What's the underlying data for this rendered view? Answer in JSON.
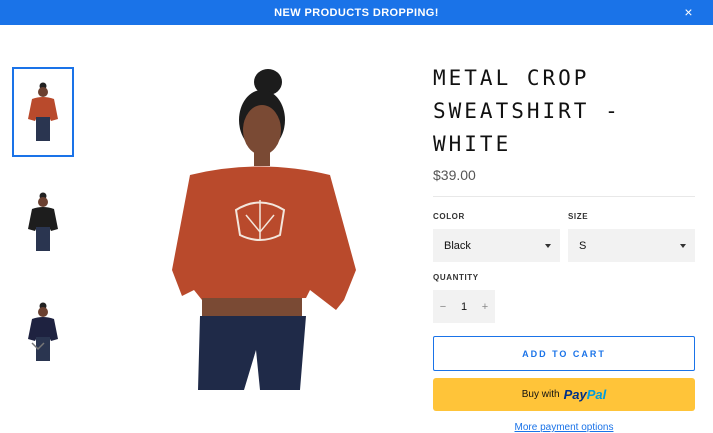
{
  "announcement": {
    "text": "NEW PRODUCTS DROPPING!",
    "close_icon": "close-icon"
  },
  "gallery": {
    "thumbnails": [
      {
        "shirt_color": "#b94a2c",
        "selected": true
      },
      {
        "shirt_color": "#1d1d1d",
        "selected": false
      },
      {
        "shirt_color": "#1e2240",
        "selected": false
      }
    ],
    "scroll_icon": "chevron-down-icon",
    "main_image_color": "#b94a2c"
  },
  "product": {
    "title_line1": "METAL CROP",
    "title_line2": "SWEATSHIRT - WHITE",
    "price": "$39.00",
    "color_label": "COLOR",
    "color_value": "Black",
    "size_label": "SIZE",
    "size_value": "S",
    "quantity_label": "QUANTITY",
    "quantity_minus": "−",
    "quantity_value": "1",
    "quantity_plus": "+",
    "add_to_cart": "ADD TO CART",
    "paypal_prefix": "Buy with",
    "paypal_brand_pay": "Pay",
    "paypal_brand_pal": "Pal",
    "more_payment": "More payment options"
  },
  "colors": {
    "accent": "#1a73e8",
    "paypal": "#ffc439"
  }
}
